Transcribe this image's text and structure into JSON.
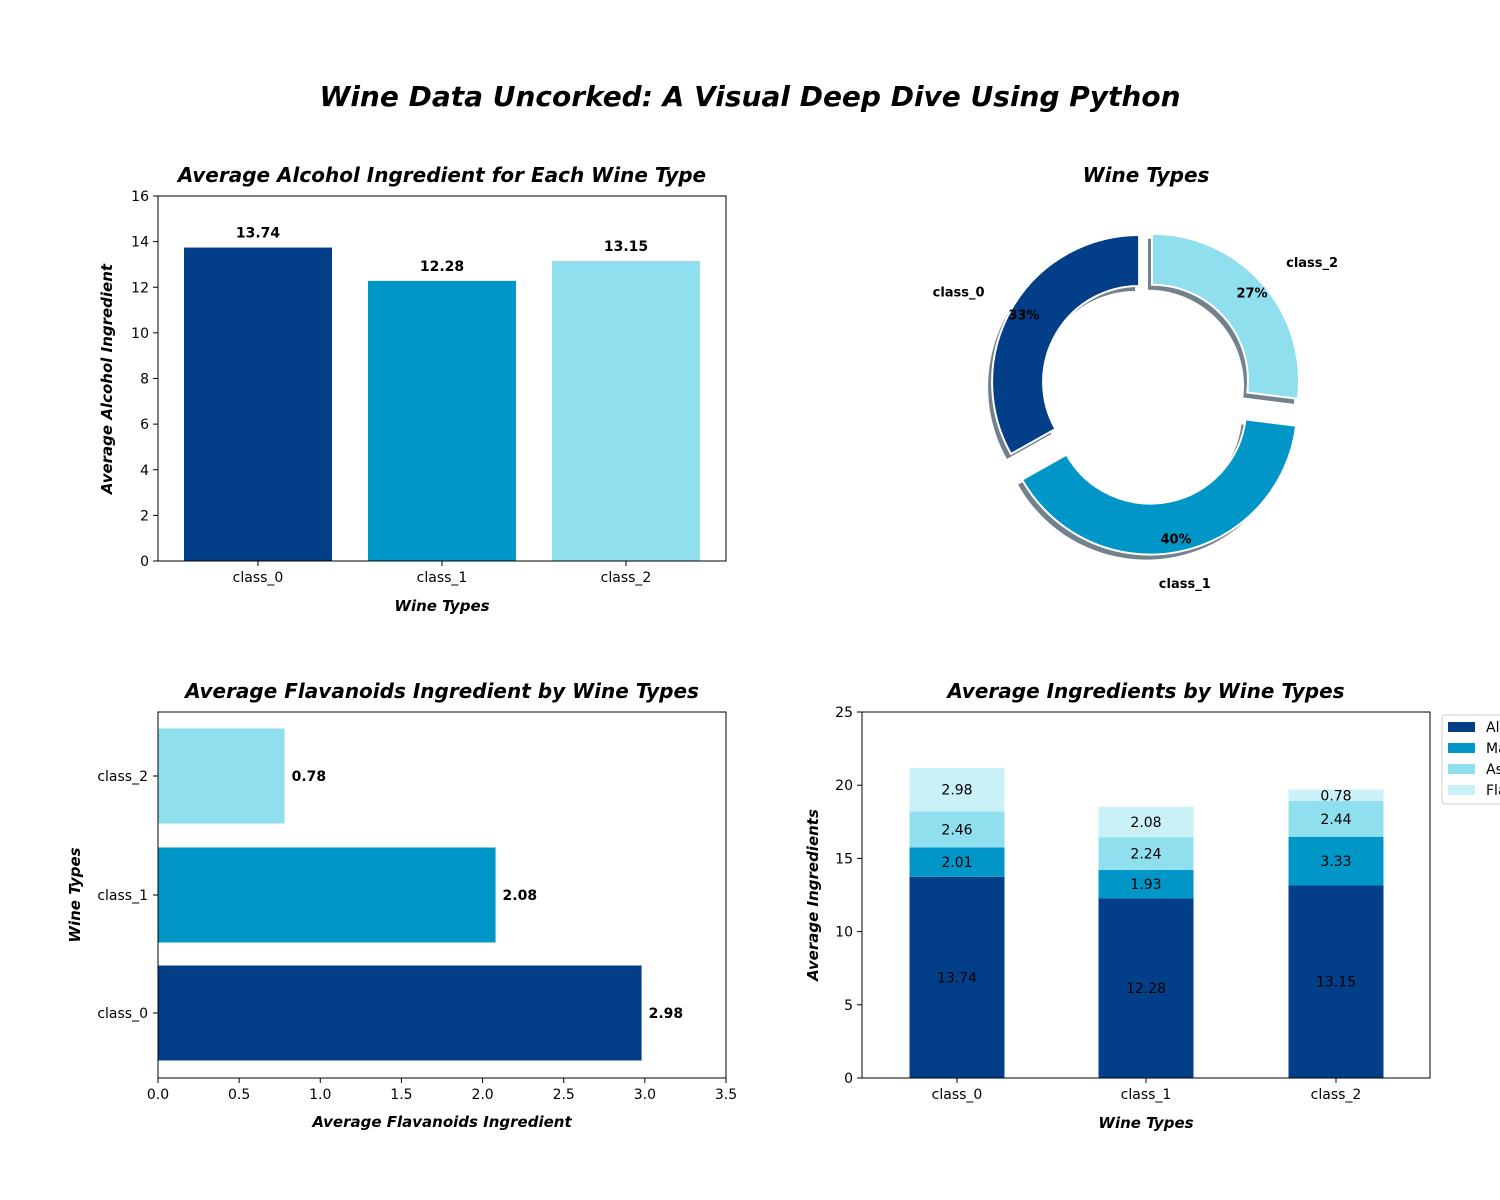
{
  "title": "Wine Data Uncorked: A Visual Deep Dive Using Python",
  "colors": {
    "class_0": "#033F89",
    "class_1": "#0096C7",
    "class_2": "#90DFEE",
    "flavanoids_stack": "#CAF0F8"
  },
  "chart_data": [
    {
      "type": "bar",
      "title": "Average Alcohol Ingredient for Each Wine Type",
      "xlabel": "Wine Types",
      "ylabel": "Average Alcohol Ingredient",
      "categories": [
        "class_0",
        "class_1",
        "class_2"
      ],
      "values": [
        13.74,
        12.28,
        13.15
      ],
      "value_labels": [
        "13.74",
        "12.28",
        "13.15"
      ],
      "ylim": [
        0,
        16
      ],
      "yticks": [
        "0",
        "2",
        "4",
        "6",
        "8",
        "10",
        "12",
        "14",
        "16"
      ],
      "grid": false
    },
    {
      "type": "pie",
      "donut": true,
      "title": "Wine Types",
      "labels": [
        "class_0",
        "class_1",
        "class_2"
      ],
      "percent_labels": [
        "33%",
        "40%",
        "27%"
      ],
      "values": [
        59,
        71,
        48
      ],
      "exploded": "class_1",
      "shadow": true
    },
    {
      "type": "bar",
      "orientation": "horizontal",
      "title": "Average Flavanoids Ingredient by Wine Types",
      "xlabel": "Average Flavanoids Ingredient",
      "ylabel": "Wine Types",
      "categories": [
        "class_0",
        "class_1",
        "class_2"
      ],
      "values": [
        2.98,
        2.08,
        0.78
      ],
      "value_labels": [
        "2.98",
        "2.08",
        "0.78"
      ],
      "xlim": [
        0,
        3.5
      ],
      "xticks": [
        "0.0",
        "0.5",
        "1.0",
        "1.5",
        "2.0",
        "2.5",
        "3.0",
        "3.5"
      ],
      "grid": false
    },
    {
      "type": "bar",
      "stacked": true,
      "title": "Average Ingredients by Wine Types",
      "xlabel": "Wine Types",
      "ylabel": "Average Ingredients",
      "categories": [
        "class_0",
        "class_1",
        "class_2"
      ],
      "ylim": [
        0,
        25
      ],
      "yticks": [
        "0",
        "5",
        "10",
        "15",
        "20",
        "25"
      ],
      "legend_position": "outside right",
      "series": [
        {
          "name": "Alc",
          "values": [
            13.74,
            12.28,
            13.15
          ],
          "labels": [
            "13.74",
            "12.28",
            "13.15"
          ]
        },
        {
          "name": "Ma",
          "values": [
            2.01,
            1.93,
            3.33
          ],
          "labels": [
            "2.01",
            "1.93",
            "3.33"
          ]
        },
        {
          "name": "As",
          "values": [
            2.46,
            2.24,
            2.44
          ],
          "labels": [
            "2.46",
            "2.24",
            "2.44"
          ]
        },
        {
          "name": "Fla",
          "values": [
            2.98,
            2.08,
            0.78
          ],
          "labels": [
            "2.98",
            "2.08",
            "0.78"
          ]
        }
      ]
    }
  ]
}
